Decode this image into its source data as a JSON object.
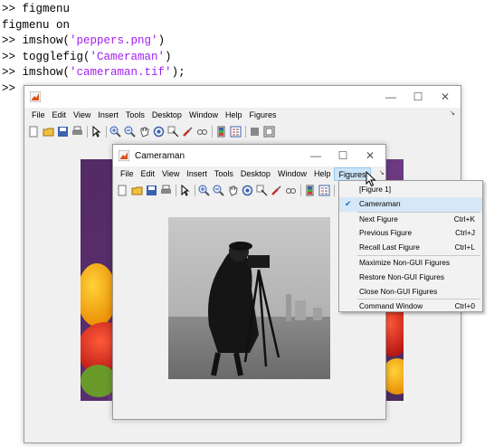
{
  "command_window": {
    "lines": [
      {
        "prompt": ">> ",
        "code": "figmenu",
        "str": "",
        "after": ""
      },
      {
        "prompt": "",
        "code": "figmenu on",
        "str": "",
        "after": ""
      },
      {
        "prompt": ">> ",
        "code": "imshow(",
        "str": "'peppers.png'",
        "after": ")"
      },
      {
        "prompt": ">> ",
        "code": "togglefig(",
        "str": "'Cameraman'",
        "after": ")"
      },
      {
        "prompt": ">> ",
        "code": "imshow(",
        "str": "'cameraman.tif'",
        "after": ");"
      },
      {
        "prompt": ">>",
        "code": "",
        "str": "",
        "after": ""
      }
    ]
  },
  "figure1": {
    "title": "",
    "menu": [
      "File",
      "Edit",
      "View",
      "Insert",
      "Tools",
      "Desktop",
      "Window",
      "Help",
      "Figures"
    ],
    "controls": {
      "minimize": "—",
      "maximize": "☐",
      "close": "✕"
    },
    "menu_arrow": "↘"
  },
  "cameraman": {
    "title": "Cameraman",
    "menu": [
      "File",
      "Edit",
      "View",
      "Insert",
      "Tools",
      "Desktop",
      "Window",
      "Help",
      "Figures"
    ],
    "active_menu": "Figures",
    "controls": {
      "minimize": "—",
      "maximize": "☐",
      "close": "✕"
    },
    "menu_arrow": "↘"
  },
  "figures_menu": {
    "items": [
      {
        "label": "[Figure 1]",
        "shortcut": "",
        "checked": false
      },
      {
        "label": "Cameraman",
        "shortcut": "",
        "checked": true
      },
      {
        "sep": true
      },
      {
        "label": "Next Figure",
        "shortcut": "Ctrl+K",
        "checked": false
      },
      {
        "label": "Previous Figure",
        "shortcut": "Ctrl+J",
        "checked": false
      },
      {
        "label": "Recall Last Figure",
        "shortcut": "Ctrl+L",
        "checked": false
      },
      {
        "sep": true
      },
      {
        "label": "Maximize Non-GUI Figures",
        "shortcut": "",
        "checked": false
      },
      {
        "label": "Restore Non-GUI Figures",
        "shortcut": "",
        "checked": false
      },
      {
        "label": "Close Non-GUI Figures",
        "shortcut": "",
        "checked": false
      },
      {
        "sep": true
      },
      {
        "label": "Command Window",
        "shortcut": "Ctrl+0",
        "checked": false
      }
    ]
  },
  "icons": {
    "toolbar": [
      "new-icon",
      "open-icon",
      "save-icon",
      "print-icon",
      "pointer-icon",
      "zoom-in-icon",
      "zoom-out-icon",
      "pan-icon",
      "rotate-icon",
      "data-cursor-icon",
      "brush-icon",
      "link-icon",
      "colorbar-icon",
      "legend-icon",
      "hide-plot-tools-icon",
      "show-plot-tools-icon"
    ],
    "check": "✔"
  },
  "colors": {
    "accent": "#1e6fd0",
    "highlight": "#cce4f7",
    "string": "#a020f0"
  }
}
